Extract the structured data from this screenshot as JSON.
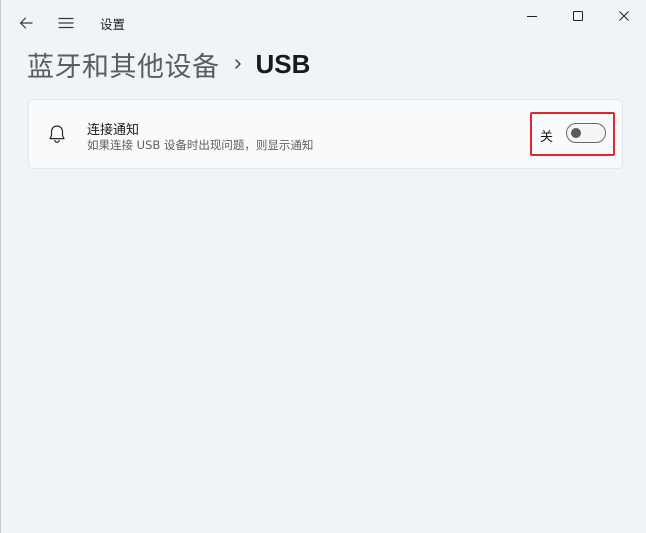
{
  "window": {
    "app_title": "设置",
    "back_icon": "back-arrow-icon",
    "menu_icon": "hamburger-icon"
  },
  "caption_buttons": {
    "minimize_icon": "minimize-icon",
    "maximize_icon": "maximize-icon",
    "close_icon": "close-icon"
  },
  "breadcrumb": {
    "parent": "蓝牙和其他设备",
    "separator_icon": "chevron-right-icon",
    "current": "USB"
  },
  "settings": {
    "connection_notifications": {
      "icon": "bell-icon",
      "title": "连接通知",
      "description": "如果连接 USB 设备时出现问题，则显示通知",
      "toggle_state_label": "关",
      "toggle_on": false
    }
  },
  "colors": {
    "background": "#eef4f8",
    "card": "#f8fafc",
    "highlight": "#e0282a"
  }
}
